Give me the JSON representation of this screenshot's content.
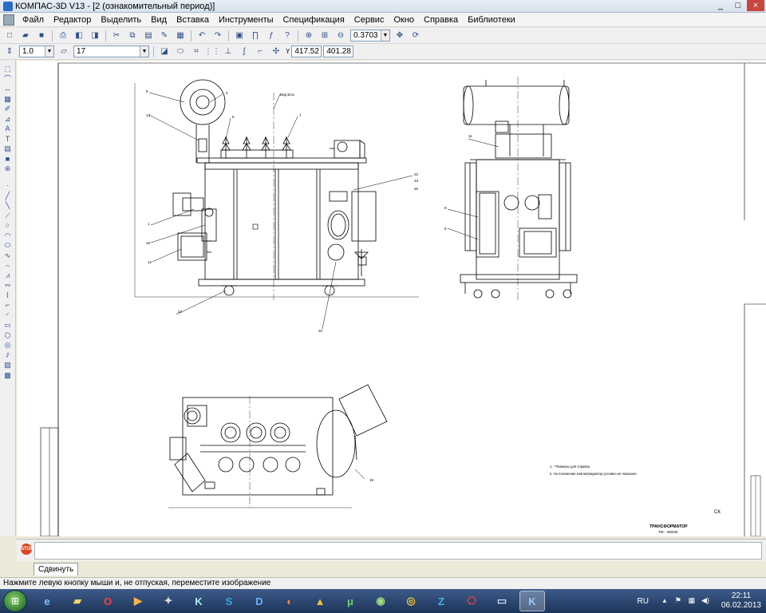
{
  "window": {
    "title": "КОМПАС-3D V13 - [2 (ознакомительный период)]",
    "controls": [
      "_",
      "□",
      "×"
    ]
  },
  "menubar": {
    "items": [
      "Файл",
      "Редактор",
      "Выделить",
      "Вид",
      "Вставка",
      "Инструменты",
      "Спецификация",
      "Сервис",
      "Окно",
      "Справка",
      "Библиотеки"
    ],
    "doc_controls": [
      "_",
      "▫",
      "×"
    ]
  },
  "toolbar": {
    "zoom": "0.3703",
    "line_scale": "1.0",
    "layer": "17",
    "coord_x_label": "Y",
    "coord_x": "417.52",
    "coord_y": "401.28"
  },
  "drawing": {
    "title_line1": "ТРАНСФОРМАТОР",
    "title_line2": "ТМ - 400/35",
    "notes": [
      "1. * Размеры для справок.",
      "2. На положение клапан/радиатор условно не показано."
    ],
    "corner_code": "СК",
    "callouts": [
      "8",
      "4",
      "13",
      "5",
      "7",
      "1",
      "10",
      "12",
      "24",
      "22",
      "23",
      "25",
      "20",
      "11",
      "9",
      "6",
      "15"
    ],
    "mark_label": "Вид Б/зз"
  },
  "propbar": {
    "stop_label": "STOP"
  },
  "tabs": {
    "move_label": "Сдвинуть"
  },
  "statusbar": {
    "hint": "Нажмите левую кнопку мыши и, не отпуская, переместите изображение"
  },
  "taskbar": {
    "apps": [
      "ie-icon",
      "folder-icon",
      "opera-icon",
      "media-icon",
      "plugin-icon",
      "kompas-icon",
      "skype-icon",
      "d-icon",
      "ring-icon",
      "a-icon",
      "torrent-icon",
      "globe-icon",
      "chrome-icon",
      "z-icon",
      "pdf-icon",
      "screen-icon",
      "kompas-active-icon"
    ],
    "lang": "RU",
    "time": "22:11",
    "date": "06.02.2013"
  }
}
